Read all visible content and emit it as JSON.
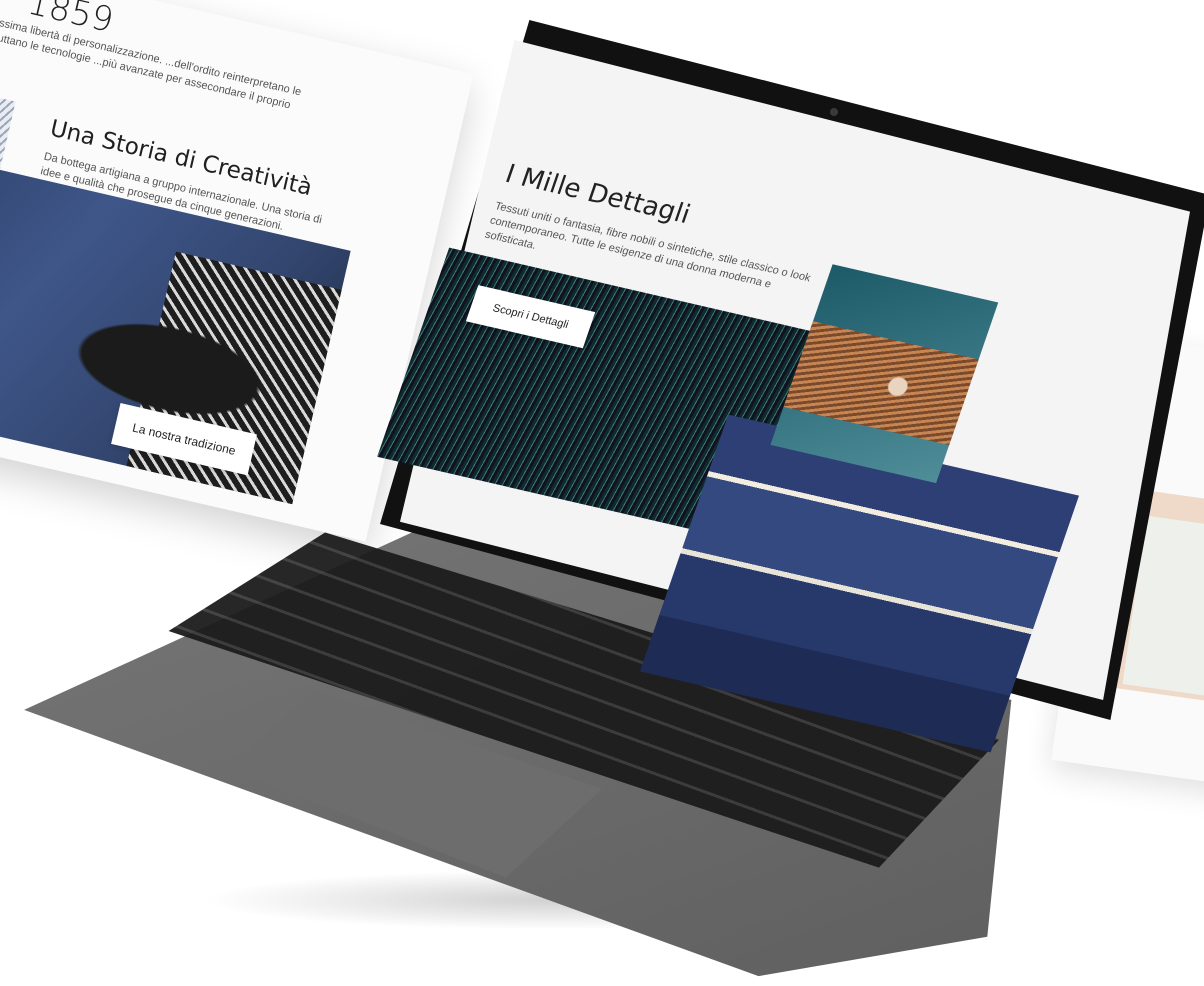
{
  "left_page": {
    "heading_fragment": "1859",
    "intro_lines": "...ssuti di qualità e massima libertà di personalizzazione. ...dell'ordito reinterpretano le forme tradizionali e sfruttano le tecnologie ...più avanzate per assecondare il proprio istinto innovatore.",
    "subheading": "Una Storia di Creatività",
    "subtext": "Da bottega artigiana a gruppo internazionale. Una storia di idee e qualità che prosegue da cinque generazioni.",
    "button_label": "La nostra tradizione"
  },
  "laptop_screen": {
    "title": "I Mille Dettagli",
    "text": "Tessuti uniti o fantasia, fibre nobili o sintetiche, stile classico o look contemporaneo. Tutte le esigenze di una donna moderna e sofisticata.",
    "button_label": "Scopri i Dettagli"
  }
}
